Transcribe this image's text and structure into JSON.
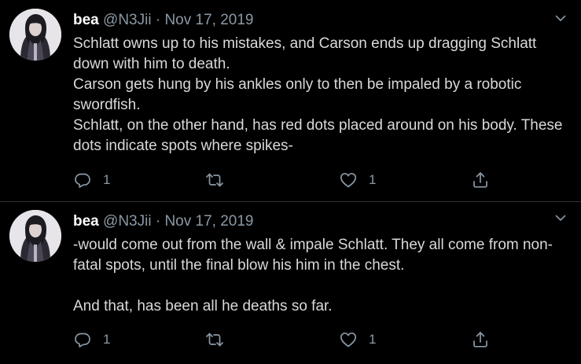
{
  "tweets": [
    {
      "author_name": "bea",
      "author_handle": "@N3Jii",
      "separator": "·",
      "date": "Nov 17, 2019",
      "lines": [
        "Schlatt owns up to his mistakes, and Carson ends up dragging Schlatt down with him to death.",
        "Carson gets hung by his ankles only to then be impaled by a robotic swordfish.",
        "Schlatt, on the other hand, has red dots placed around on his body. These dots indicate spots where spikes-"
      ],
      "reply_count": "1",
      "retweet_count": "",
      "like_count": "1",
      "icons": {
        "reply": "reply-icon",
        "retweet": "retweet-icon",
        "like": "like-icon",
        "share": "share-icon",
        "menu": "chevron-down-icon"
      }
    },
    {
      "author_name": "bea",
      "author_handle": "@N3Jii",
      "separator": "·",
      "date": "Nov 17, 2019",
      "lines": [
        "-would come out from the wall & impale Schlatt. They all come from non-fatal spots, until the final blow his him in the chest.",
        "",
        "And that, has been all he deaths so far."
      ],
      "reply_count": "1",
      "retweet_count": "",
      "like_count": "1",
      "icons": {
        "reply": "reply-icon",
        "retweet": "retweet-icon",
        "like": "like-icon",
        "share": "share-icon",
        "menu": "chevron-down-icon"
      }
    }
  ],
  "colors": {
    "background": "#000000",
    "text": "#d9d9d9",
    "name": "#ffffff",
    "secondary": "#8b98a5",
    "divider": "#2f3336"
  }
}
